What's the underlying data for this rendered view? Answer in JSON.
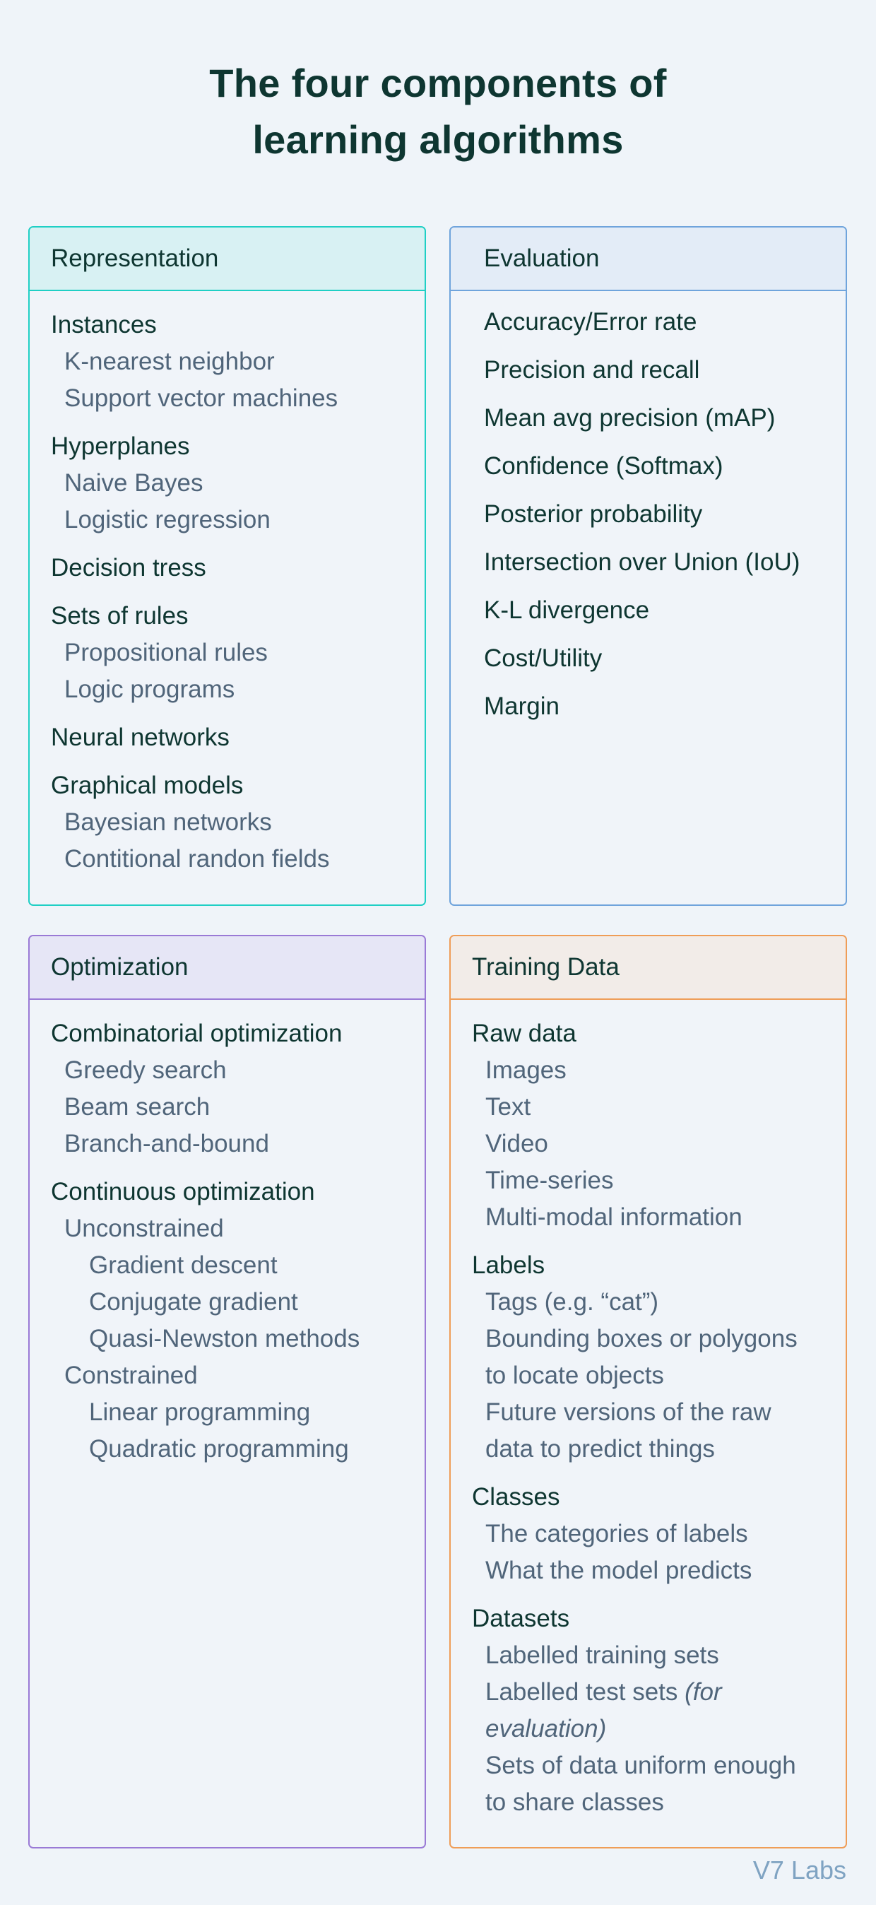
{
  "title": {
    "line1": "The four components of",
    "line2": "learning algorithms"
  },
  "cards": {
    "representation": {
      "title": "Representation",
      "groups": [
        {
          "label": "Instances",
          "items": [
            "K-nearest neighbor",
            "Support vector machines"
          ]
        },
        {
          "label": "Hyperplanes",
          "items": [
            "Naive Bayes",
            "Logistic regression"
          ]
        },
        {
          "label": "Decision tress",
          "items": []
        },
        {
          "label": "Sets of rules",
          "items": [
            "Propositional rules",
            "Logic programs"
          ]
        },
        {
          "label": "Neural networks",
          "items": []
        },
        {
          "label": "Graphical models",
          "items": [
            "Bayesian networks",
            "Contitional randon fields"
          ]
        }
      ]
    },
    "evaluation": {
      "title": "Evaluation",
      "items": [
        "Accuracy/Error rate",
        "Precision and recall",
        "Mean avg precision (mAP)",
        "Confidence (Softmax)",
        "Posterior probability",
        "Intersection over Union (IoU)",
        "K-L divergence",
        "Cost/Utility",
        "Margin"
      ]
    },
    "optimization": {
      "title": "Optimization",
      "groups": [
        {
          "label": "Combinatorial optimization",
          "items": [
            "Greedy search",
            "Beam search",
            "Branch-and-bound"
          ]
        },
        {
          "label": "Continuous optimization",
          "sub": [
            {
              "label": "Unconstrained",
              "items": [
                "Gradient descent",
                "Conjugate gradient",
                "Quasi-Newston methods"
              ]
            },
            {
              "label": "Constrained",
              "items": [
                "Linear programming",
                "Quadratic programming"
              ]
            }
          ]
        }
      ]
    },
    "training_data": {
      "title": "Training Data",
      "groups": [
        {
          "label": "Raw data",
          "items": [
            "Images",
            "Text",
            "Video",
            "Time-series",
            "Multi-modal information"
          ]
        },
        {
          "label": "Labels",
          "items": [
            "Tags (e.g. “cat”)",
            "Bounding boxes or polygons",
            "to locate objects",
            "Future versions of the raw",
            "data to predict things"
          ]
        },
        {
          "label": "Classes",
          "items": [
            "The categories of labels",
            "What the model predicts"
          ]
        },
        {
          "label": "Datasets",
          "items": [
            "Labelled training sets"
          ],
          "test_sets": {
            "text": "Labelled test sets ",
            "italic_1": "(for",
            "italic_2": "evaluation)"
          },
          "items_after": [
            "Sets of data uniform enough",
            "to share classes"
          ]
        }
      ]
    }
  },
  "footer": "V7 Labs",
  "colors": {
    "background": "#eff4f9",
    "representation": "#1fcfc5",
    "evaluation": "#6fa4dc",
    "optimization": "#9a7ad6",
    "training_data": "#ef9d57",
    "heading_text": "#0e3631",
    "sub_text": "#50657a"
  }
}
